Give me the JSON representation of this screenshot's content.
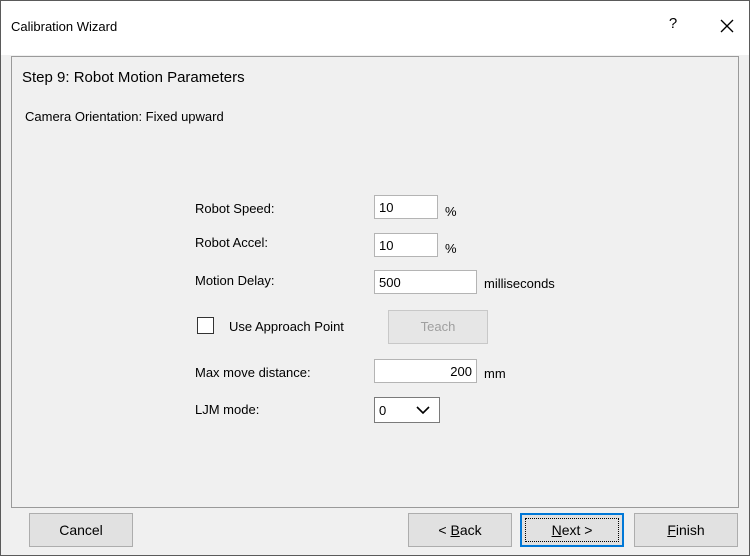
{
  "window": {
    "title": "Calibration Wizard",
    "help_label": "?",
    "close_icon": "close-icon"
  },
  "step": {
    "title": "Step 9: Robot Motion Parameters",
    "orientation": "Camera Orientation: Fixed upward"
  },
  "fields": {
    "robot_speed": {
      "label": "Robot Speed:",
      "value": "10",
      "unit": "%"
    },
    "robot_accel": {
      "label": "Robot Accel:",
      "value": "10",
      "unit": "%"
    },
    "motion_delay": {
      "label": "Motion Delay:",
      "value": "500",
      "unit": "milliseconds"
    },
    "use_approach_point": {
      "label": "Use Approach Point",
      "checked": false
    },
    "teach_button": {
      "label": "Teach",
      "enabled": false
    },
    "max_move_distance": {
      "label": "Max move distance:",
      "value": "200",
      "unit": "mm"
    },
    "ljm_mode": {
      "label": "LJM mode:",
      "value": "0",
      "icon": "chevron-down-icon"
    }
  },
  "footer": {
    "cancel": "Cancel",
    "back": {
      "prefix": "< ",
      "mnemonic": "B",
      "rest": "ack"
    },
    "next": {
      "mnemonic": "N",
      "rest": "ext >"
    },
    "finish": {
      "mnemonic": "F",
      "rest": "inish"
    }
  },
  "colors": {
    "accent": "#0078d7",
    "window_bg": "#f0f0f0",
    "disabled_text": "#9f9f9f"
  }
}
